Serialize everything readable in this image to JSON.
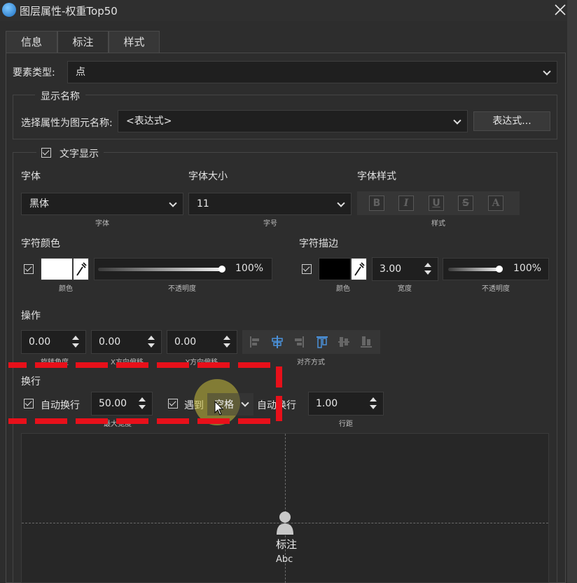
{
  "window": {
    "title": "图层属性-权重Top50",
    "close_icon": "close-icon",
    "app_icon": "globe-icon"
  },
  "tabs": [
    {
      "label": "信息"
    },
    {
      "label": "标注"
    },
    {
      "label": "样式"
    }
  ],
  "feature_type": {
    "label": "要素类型:",
    "value": "点"
  },
  "display_name": {
    "group_title": "显示名称",
    "label": "选择属性为图元名称:",
    "value": "<表达式>",
    "button": "表达式..."
  },
  "text_display": {
    "group_title": "文字显示",
    "checked": true
  },
  "font": {
    "label": "字体",
    "value": "黑体",
    "caption": "字体"
  },
  "font_size": {
    "label": "字体大小",
    "value": "11",
    "caption": "字号"
  },
  "font_style": {
    "label": "字体样式",
    "caption": "样式",
    "buttons": [
      "B",
      "I",
      "U",
      "S",
      "A"
    ]
  },
  "char_color": {
    "label": "字符颜色",
    "checked": true,
    "color": "#ffffff",
    "color_caption": "颜色",
    "opacity": "100%",
    "opacity_value": 1.0,
    "opacity_caption": "不透明度"
  },
  "char_outline": {
    "label": "字符描边",
    "checked": true,
    "color": "#000000",
    "color_caption": "颜色",
    "width": "3.00",
    "width_caption": "宽度",
    "opacity": "100%",
    "opacity_value": 1.0,
    "opacity_caption": "不透明度"
  },
  "operation": {
    "label": "操作",
    "rotation": "0.00",
    "rotation_caption": "旋转角度",
    "x_offset": "0.00",
    "x_offset_caption": "X方向偏移",
    "y_offset": "0.00",
    "y_offset_caption": "Y方向偏移",
    "align_caption": "对齐方式"
  },
  "wrap": {
    "label": "换行",
    "auto_wrap_label": "自动换行",
    "auto_wrap_checked": true,
    "max_width": "50.00",
    "max_width_caption": "最大宽度",
    "meet_label": "遇到",
    "meet_checked": true,
    "meet_value": "空格",
    "meet_suffix": "自动换行",
    "line_spacing": "1.00",
    "line_spacing_caption": "行距"
  },
  "preview": {
    "symbol_icon": "person-marker-icon",
    "label_text": "标注",
    "sample_text": "Abc"
  },
  "colors": {
    "highlight_dash": "#e8101a",
    "accent_blue": "#4a90d9"
  }
}
